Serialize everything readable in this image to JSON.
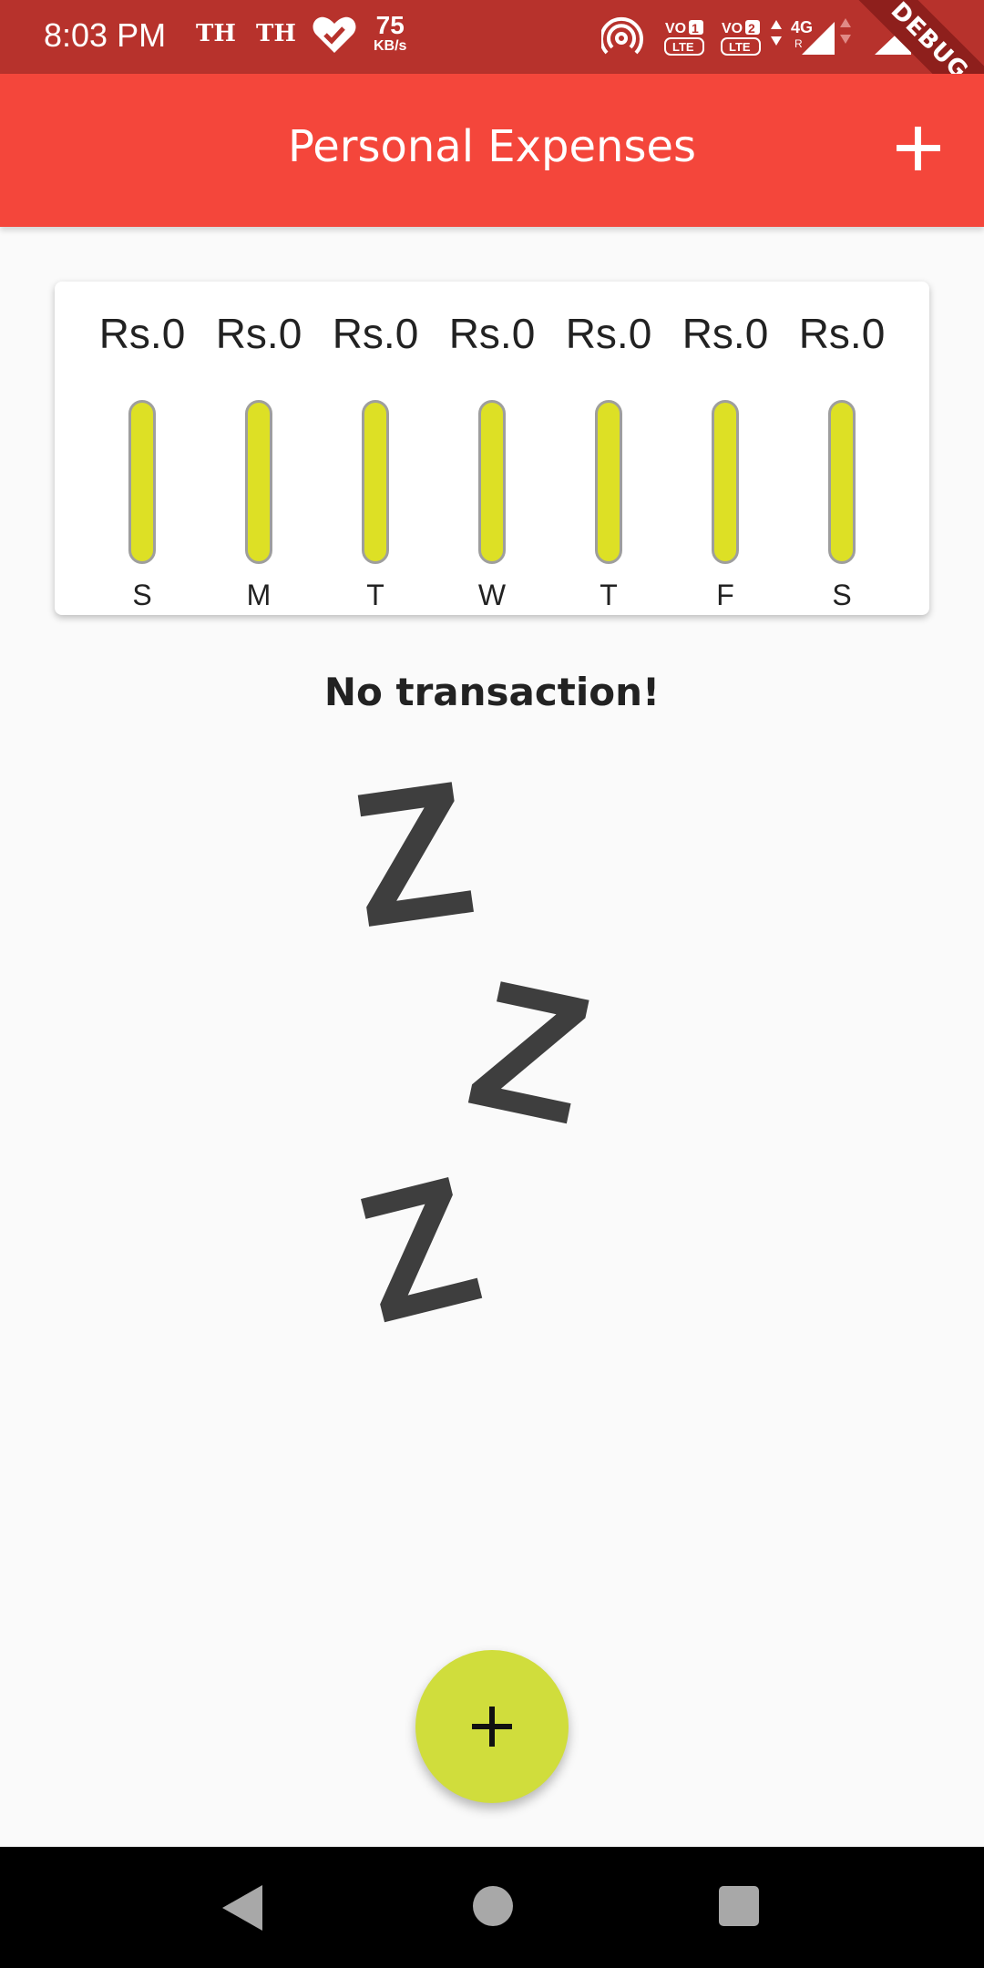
{
  "status_bar": {
    "time": "8:03 PM",
    "carrier1": "TH",
    "carrier2": "TH",
    "speed_value": "75",
    "speed_unit": "KB/s",
    "debug_banner": "DEBUG",
    "icons": [
      "heart-check-icon",
      "hotspot-icon",
      "volte1-icon",
      "volte2-icon",
      "4g-signal-icon",
      "signal-icon",
      "battery-icon"
    ]
  },
  "app_bar": {
    "title": "Personal Expenses",
    "add_icon": "plus-icon"
  },
  "chart_data": {
    "type": "bar",
    "categories": [
      "S",
      "M",
      "T",
      "W",
      "T",
      "F",
      "S"
    ],
    "values": [
      0,
      0,
      0,
      0,
      0,
      0,
      0
    ],
    "labels": [
      "Rs.0",
      "Rs.0",
      "Rs.0",
      "Rs.0",
      "Rs.0",
      "Rs.0",
      "Rs.0"
    ]
  },
  "empty_state": {
    "message": "No transaction!",
    "image_icon": "sleeping-zzz-icon"
  },
  "fab": {
    "icon": "plus-icon"
  },
  "nav_bar": {
    "icons": [
      "back-icon",
      "home-icon",
      "recent-apps-icon"
    ]
  },
  "colors": {
    "status_bar": "#b7322c",
    "app_bar": "#f4463b",
    "bar_fill": "#dde025",
    "fab": "#d0dd3c",
    "background": "#fafafa"
  }
}
